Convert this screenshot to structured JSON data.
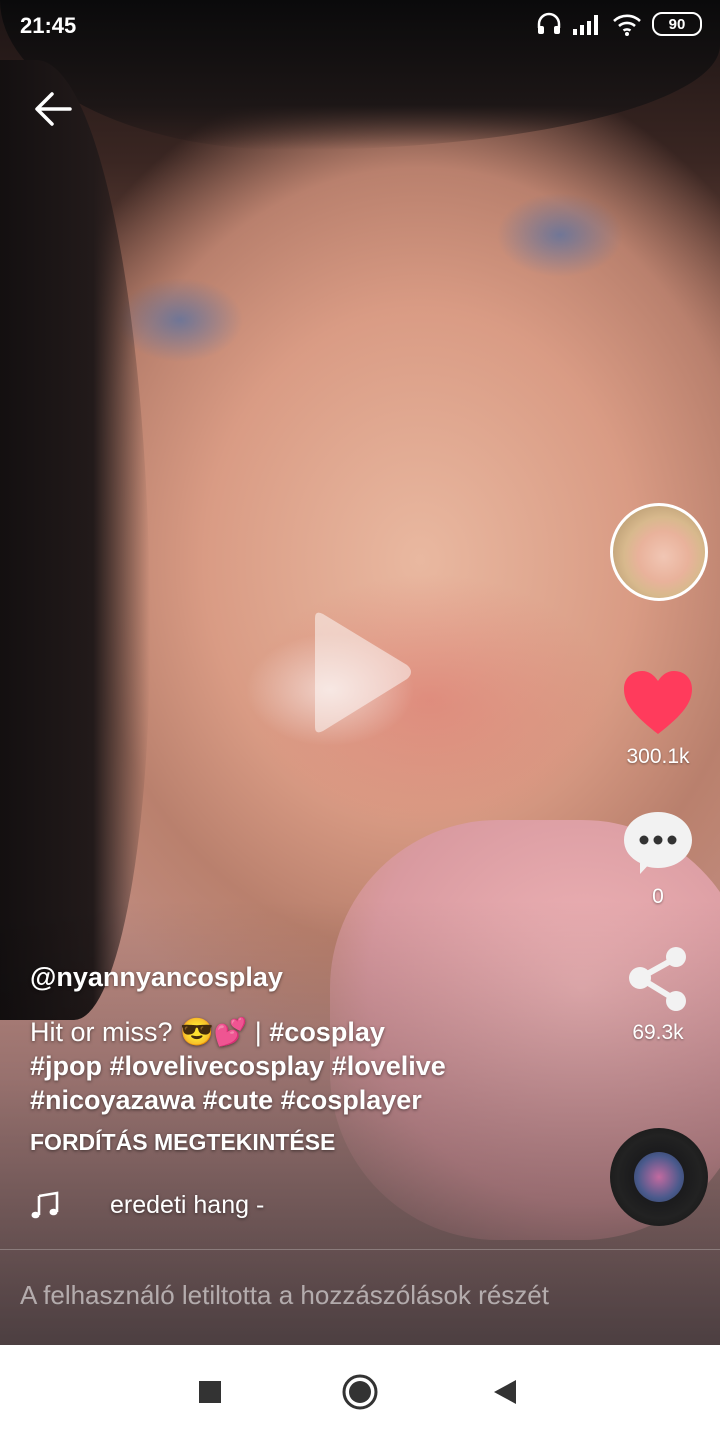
{
  "status_bar": {
    "time": "21:45",
    "battery": "90"
  },
  "video": {
    "username": "@nyannyancosplay",
    "description_text": "Hit or miss? 😎💕 | ",
    "hashtags_line1": [
      "#cosplay"
    ],
    "hashtags_line2": [
      "#jpop",
      "#lovelivecosplay",
      "#lovelive"
    ],
    "hashtags_line3": [
      "#nicoyazawa",
      "#cute",
      "#cosplayer"
    ],
    "translate_label": "FORDÍTÁS MEGTEKINTÉSE",
    "sound_label": "eredeti hang -"
  },
  "actions": {
    "likes": "300.1k",
    "comments": "0",
    "shares": "69.3k"
  },
  "comments_disabled_text": "A felhasználó letiltotta a hozzászólások részét",
  "colors": {
    "like_heart": "#ff3b5c",
    "text": "#ffffff"
  },
  "icons": {
    "back": "arrow-left-icon",
    "like": "heart-icon",
    "comment": "comment-bubble-icon",
    "share": "share-icon",
    "sound": "music-note-icon",
    "play": "play-icon"
  }
}
